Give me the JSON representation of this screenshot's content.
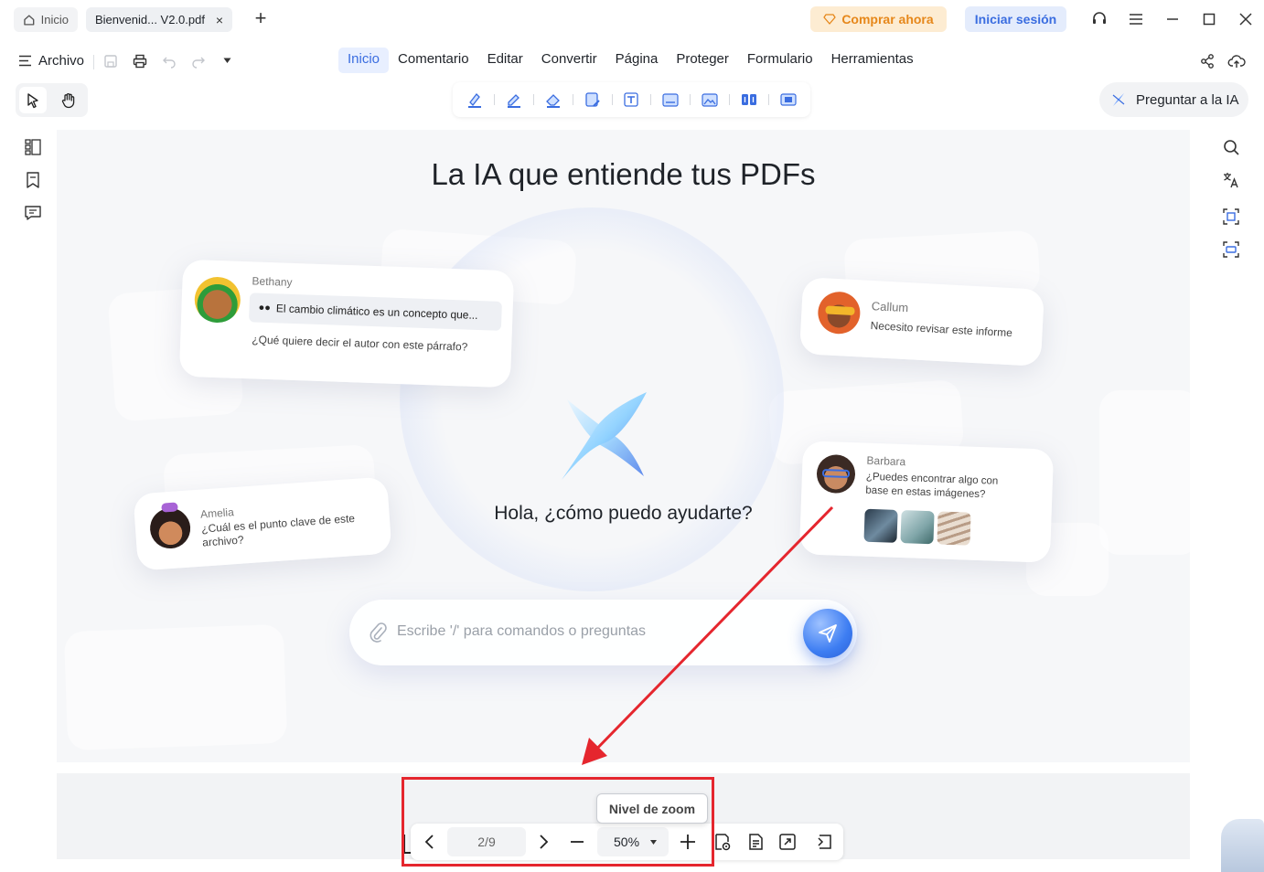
{
  "tabs": {
    "home_label": "Inicio",
    "doc_label": "Bienvenid... V2.0.pdf",
    "close_glyph": "×",
    "new_tab_glyph": "+"
  },
  "titlebar": {
    "buy_label": "Comprar ahora",
    "login_label": "Iniciar sesión"
  },
  "menubar": {
    "file_label": "Archivo",
    "items": [
      "Inicio",
      "Comentario",
      "Editar",
      "Convertir",
      "Página",
      "Proteger",
      "Formulario",
      "Herramientas"
    ],
    "active_index": 0
  },
  "toolbar": {
    "ask_ai_label": "Preguntar a la IA",
    "quick_tools": [
      "highlight-icon",
      "markup-icon",
      "eraser-icon",
      "edit-text-icon",
      "text-box-icon",
      "ocr-icon",
      "image-icon",
      "compare-icon",
      "redact-icon"
    ]
  },
  "canvas": {
    "title": "La IA que entiende tus PDFs",
    "greeting": "Hola, ¿cómo puedo ayudarte?",
    "input_placeholder": "Escribe '/' para comandos o preguntas",
    "cards": {
      "bethany": {
        "name": "Bethany",
        "bubble": "El cambio climático es un concepto que...",
        "question": "¿Qué quiere decir el autor con este párrafo?"
      },
      "callum": {
        "name": "Callum",
        "message": "Necesito revisar este informe"
      },
      "amelia": {
        "name": "Amelia",
        "message": "¿Cuál es el punto clave de este archivo?"
      },
      "barbara": {
        "name": "Barbara",
        "message": "¿Puedes encontrar algo con base en estas imágenes?"
      }
    }
  },
  "navigation": {
    "page_indicator": "2/9",
    "zoom_value": "50%",
    "zoom_tooltip": "Nivel de zoom"
  },
  "colors": {
    "accent": "#3a6de0",
    "buy": "#e6871a",
    "highlight": "#e5262e"
  }
}
